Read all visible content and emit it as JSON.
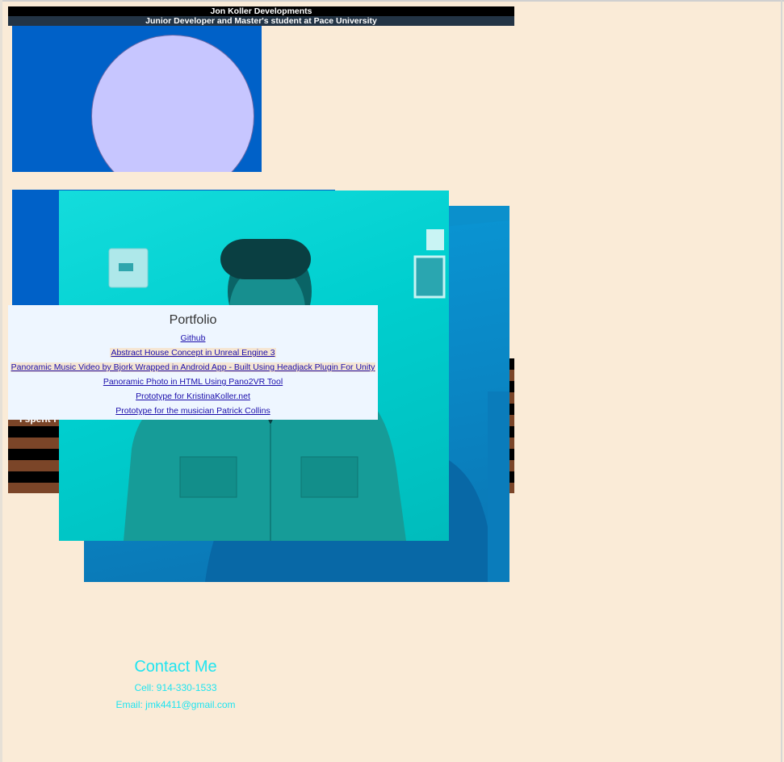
{
  "header": {
    "title": "Jon Koller Developments",
    "subtitle": "Junior Developer and Master's student at Pace University"
  },
  "about": {
    "snippet": "I spent f"
  },
  "portfolio": {
    "title": "Portfolio",
    "links": [
      "Github",
      "Abstract House Concept in Unreal Engine 3",
      "Panoramic Music Video by Bjork Wrapped in Android App - Built Using Headjack Plugin For Unity",
      "Panoramic Photo in HTML Using Pano2VR Tool",
      "Prototype for KristinaKoller.net",
      "Prototype for the musician Patrick Collins"
    ]
  },
  "contact": {
    "title": "Contact Me",
    "cell": "Cell: 914-330-1533",
    "email": "Email: jmk4411@gmail.com"
  },
  "colors": {
    "page_bg": "#faebd7",
    "header_bg": "#000000",
    "subheader_bg": "#233445",
    "blue_panel": "#0061c8",
    "avatar_circle": "#c7c6ff",
    "photo_front": "#00cfcf",
    "photo_back": "#0a86c4",
    "portfolio_bg": "#eef6ff",
    "link": "#1a0dab",
    "contact_text": "#1fe4f0",
    "stripe_dark": "#000000",
    "stripe_brown": "#7b4528"
  }
}
